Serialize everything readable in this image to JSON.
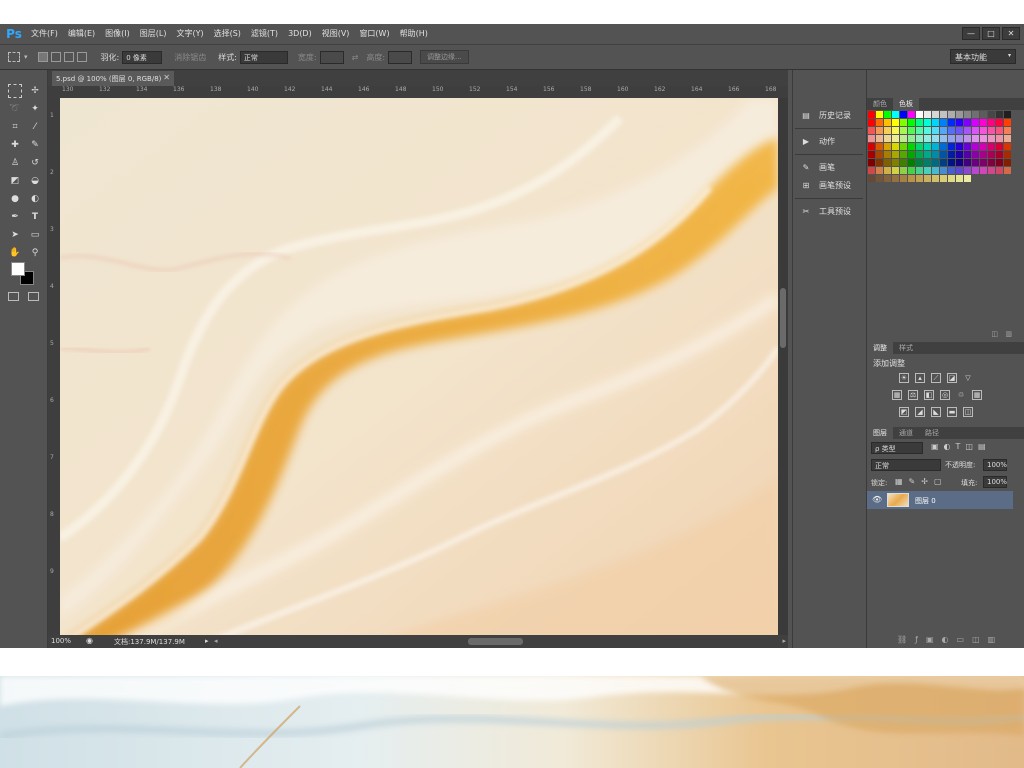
{
  "app": {
    "logo": "Ps"
  },
  "menu": [
    "文件(F)",
    "编辑(E)",
    "图像(I)",
    "图层(L)",
    "文字(Y)",
    "选择(S)",
    "滤镜(T)",
    "3D(D)",
    "视图(V)",
    "窗口(W)",
    "帮助(H)"
  ],
  "window_controls": [
    "—",
    "□",
    "✕"
  ],
  "options": {
    "feather_label": "羽化:",
    "feather_value": "0 像素",
    "antialias_label": "消除锯齿",
    "style_label": "样式:",
    "style_value": "正常",
    "width_label": "宽度:",
    "height_label": "高度:",
    "refine_button": "调整边缘...",
    "workspace": "基本功能"
  },
  "document": {
    "tab_title": "5.psd @ 100% (图层 0, RGB/8)",
    "close": "✕"
  },
  "ruler_top": [
    "130",
    "132",
    "134",
    "136",
    "138",
    "140",
    "142",
    "144",
    "146",
    "148",
    "150",
    "152",
    "154",
    "156",
    "158",
    "160",
    "162",
    "164",
    "166",
    "168"
  ],
  "ruler_left": [
    "1",
    "2",
    "3",
    "4",
    "5",
    "6",
    "7",
    "8",
    "9"
  ],
  "status": {
    "zoom": "100%",
    "doc_info": "文档:137.9M/137.9M"
  },
  "mid_panel": {
    "history": "历史记录",
    "actions": "动作",
    "brush": "画笔",
    "brush_presets": "画笔预设",
    "tool_presets": "工具预设"
  },
  "color_panel": {
    "tabs": [
      "颜色",
      "色板"
    ],
    "active": "色板"
  },
  "adjust_panel": {
    "tabs": [
      "调整",
      "样式"
    ],
    "active": "调整",
    "title": "添加调整"
  },
  "layers_panel": {
    "tabs": [
      "图层",
      "通道",
      "路径"
    ],
    "active": "图层",
    "filter": "ρ 类型",
    "blend_mode": "正常",
    "opacity_label": "不透明度:",
    "opacity_value": "100%",
    "lock_label": "锁定:",
    "fill_label": "填充:",
    "fill_value": "100%",
    "layer_name": "图层 0"
  },
  "icons": [
    "marquee-icon",
    "move-icon",
    "lasso-icon",
    "magic-wand-icon",
    "crop-icon",
    "eyedropper-icon",
    "heal-icon",
    "brush-icon",
    "stamp-icon",
    "history-brush-icon",
    "eraser-icon",
    "bucket-icon",
    "blur-icon",
    "dodge-icon",
    "pen-icon",
    "type-icon",
    "path-select-icon",
    "shape-icon",
    "hand-icon",
    "zoom-icon",
    "eye-icon",
    "gear-icon"
  ]
}
